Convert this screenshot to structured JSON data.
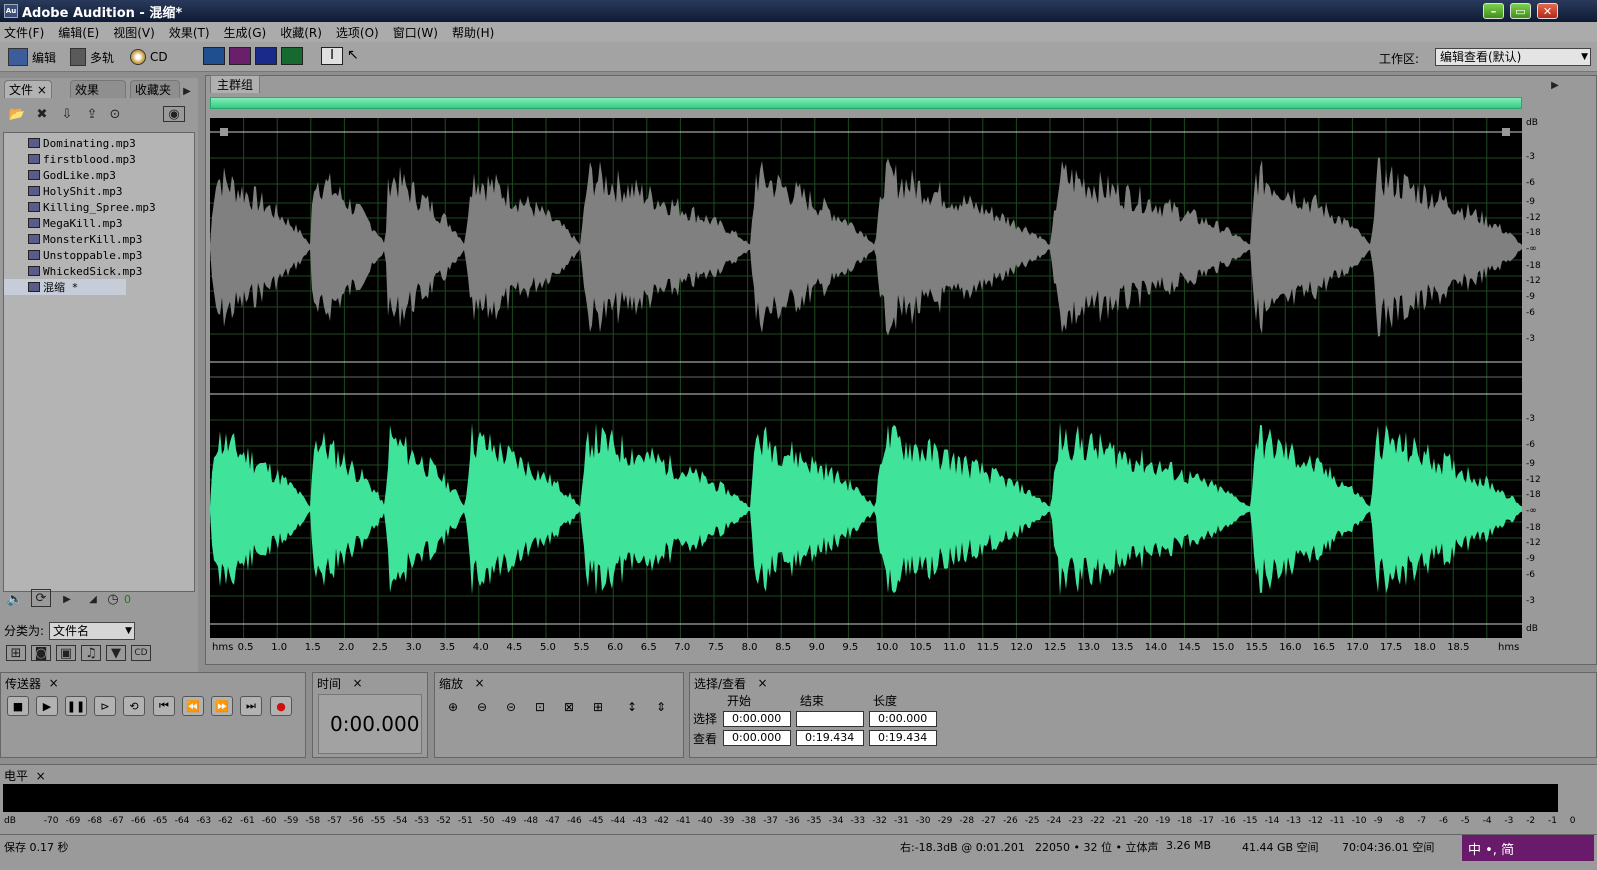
{
  "window": {
    "title": "Adobe Audition - 混缩*",
    "logo": "Au"
  },
  "menu": [
    "文件(F)",
    "编辑(E)",
    "视图(V)",
    "效果(T)",
    "生成(G)",
    "收藏(R)",
    "选项(O)",
    "窗口(W)",
    "帮助(H)"
  ],
  "toolbar": {
    "edit_label": "编辑",
    "multitrack_label": "多轨",
    "cd_label": "CD",
    "workspace_label": "工作区:",
    "workspace_value": "编辑查看(默认)"
  },
  "left_panel": {
    "tabs": [
      "文件",
      "效果",
      "收藏夹"
    ],
    "files": [
      "Dominating.mp3",
      "firstblood.mp3",
      "GodLike.mp3",
      "HolyShit.mp3",
      "Killing_Spree.mp3",
      "MegaKill.mp3",
      "MonsterKill.mp3",
      "Unstoppable.mp3",
      "WhickedSick.mp3",
      "混缩 *"
    ],
    "volume_value": "0",
    "sort_label": "分类为:",
    "sort_value": "文件名"
  },
  "main_panel": {
    "tab": "主群组",
    "db_label": "dB"
  },
  "db_ticks": [
    "-3",
    "-6",
    "-9",
    "-12",
    "-18",
    "-∞",
    "-18",
    "-12",
    "-9",
    "-6",
    "-3"
  ],
  "time_ticks": [
    "hms",
    "0.5",
    "1.0",
    "1.5",
    "2.0",
    "2.5",
    "3.0",
    "3.5",
    "4.0",
    "4.5",
    "5.0",
    "5.5",
    "6.0",
    "6.5",
    "7.0",
    "7.5",
    "8.0",
    "8.5",
    "9.0",
    "9.5",
    "10.0",
    "10.5",
    "11.0",
    "11.5",
    "12.0",
    "12.5",
    "13.0",
    "13.5",
    "14.0",
    "14.5",
    "15.0",
    "15.5",
    "16.0",
    "16.5",
    "17.0",
    "17.5",
    "18.0",
    "18.5",
    "hms"
  ],
  "transport": {
    "title": "传送器"
  },
  "time_panel": {
    "title": "时间",
    "value": "0:00.000"
  },
  "zoom_panel": {
    "title": "缩放"
  },
  "selection_panel": {
    "title": "选择/查看",
    "col_start": "开始",
    "col_end": "结束",
    "col_length": "长度",
    "row_select": "选择",
    "row_view": "查看",
    "select_start": "0:00.000",
    "select_end": "",
    "select_length": "0:00.000",
    "view_start": "0:00.000",
    "view_end": "0:19.434",
    "view_length": "0:19.434"
  },
  "level_panel": {
    "title": "电平",
    "ticks": [
      "dB",
      "-70",
      "-69",
      "-68",
      "-67",
      "-66",
      "-65",
      "-64",
      "-63",
      "-62",
      "-61",
      "-60",
      "-59",
      "-58",
      "-57",
      "-56",
      "-55",
      "-54",
      "-53",
      "-52",
      "-51",
      "-50",
      "-49",
      "-48",
      "-47",
      "-46",
      "-45",
      "-44",
      "-43",
      "-42",
      "-41",
      "-40",
      "-39",
      "-38",
      "-37",
      "-36",
      "-35",
      "-34",
      "-33",
      "-32",
      "-31",
      "-30",
      "-29",
      "-28",
      "-27",
      "-26",
      "-25",
      "-24",
      "-23",
      "-22",
      "-21",
      "-20",
      "-19",
      "-18",
      "-17",
      "-16",
      "-15",
      "-14",
      "-13",
      "-12",
      "-11",
      "-10",
      "-9",
      "-8",
      "-7",
      "-6",
      "-5",
      "-4",
      "-3",
      "-2",
      "-1",
      "0"
    ]
  },
  "status": {
    "saved": "保存 0.17 秒",
    "cursor": "右:-18.3dB @   0:01.201",
    "format": "22050 • 32 位 • 立体声",
    "size": "3.26 MB",
    "disk": "41.44 GB 空间",
    "time_free": "70:04:36.01 空间",
    "ime": "中 •, 简"
  },
  "colors": {
    "left_channel": "#808080",
    "right_channel": "#3fe39a",
    "background": "#000000"
  }
}
